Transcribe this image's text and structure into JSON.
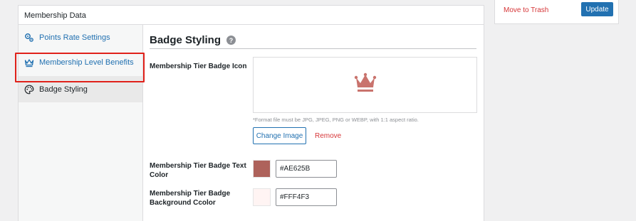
{
  "metabox": {
    "title": "Membership Data"
  },
  "sidebar": {
    "items": [
      {
        "label": "Points Rate Settings",
        "icon": "gear-cog-icon"
      },
      {
        "label": "Membership Level Benefits",
        "icon": "crown-outline-icon"
      },
      {
        "label": "Badge Styling",
        "icon": "palette-icon",
        "active": true
      }
    ]
  },
  "content": {
    "title": "Badge Styling",
    "help": "?",
    "icon_label": "Membership Tier Badge Icon",
    "icon_note": "*Format file must be JPG, JPEG, PNG or WEBP, with 1:1 aspect ratio.",
    "change_image": "Change Image",
    "remove": "Remove",
    "text_color_label_1": "Membership Tier Badge Text",
    "text_color_label_2": "Color",
    "text_color_value": "#AE625B",
    "bg_color_label_1": "Membership Tier Badge",
    "bg_color_label_2": "Background Ccolor",
    "bg_color_value": "#FFF4F3"
  },
  "publish": {
    "trash": "Move to Trash",
    "update": "Update"
  },
  "colors": {
    "accent": "#2271b1",
    "danger": "#d63638",
    "highlight": "#e0211a",
    "badge": "#c9736d"
  }
}
